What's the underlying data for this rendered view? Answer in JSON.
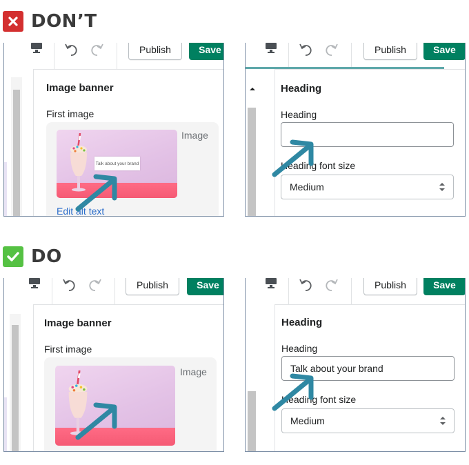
{
  "sections": {
    "dont": {
      "label": "DON’T"
    },
    "do": {
      "label": "DO"
    }
  },
  "toolbar": {
    "publish_label": "Publish",
    "save_label": "Save"
  },
  "image_banner": {
    "title": "Image banner",
    "field_label": "First image",
    "image_word": "Image",
    "edit_alt_text": "Edit alt text",
    "sticker_text": "Talk about your brand"
  },
  "heading_panel": {
    "title": "Heading",
    "heading_label": "Heading",
    "heading_value_dont": "",
    "heading_value_do": "Talk about your brand",
    "font_size_label": "Heading font size",
    "font_size_value": "Medium"
  },
  "colors": {
    "dont_badge": "#d32f2f",
    "do_badge": "#55c143",
    "save_green": "#008060",
    "arrow": "#2f88a3",
    "link_blue": "#2c6ecb"
  },
  "icons": [
    "close-icon",
    "checkmark-icon",
    "desktop-icon",
    "undo-icon",
    "redo-icon",
    "pointer-arrow-icon",
    "select-arrows-icon"
  ]
}
